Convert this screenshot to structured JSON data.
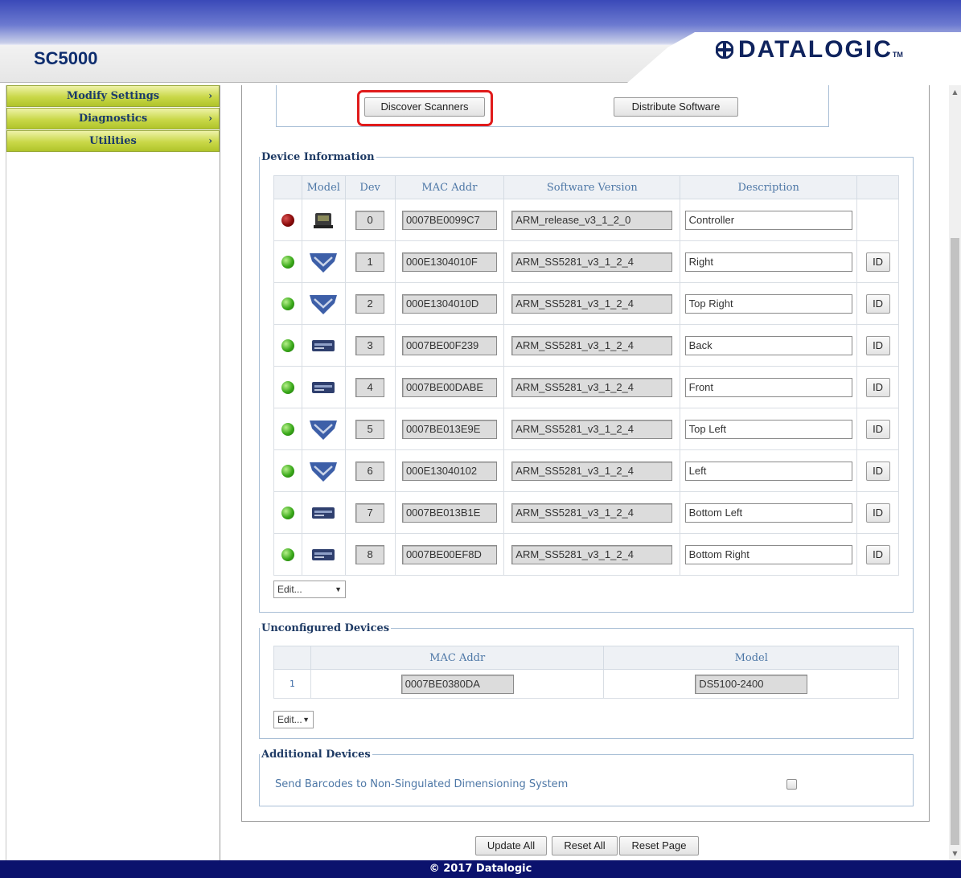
{
  "header": {
    "app_title": "SC5000",
    "brand": "DATALOGIC",
    "brand_tm": "TM"
  },
  "sidebar": {
    "items": [
      {
        "label": "Modify Settings",
        "chevron": "›"
      },
      {
        "label": "Diagnostics",
        "chevron": "›"
      },
      {
        "label": "Utilities",
        "chevron": "›"
      }
    ]
  },
  "actions": {
    "discover_label": "Discover Scanners",
    "distribute_label": "Distribute Software"
  },
  "device_info": {
    "legend": "Device Information",
    "columns": [
      "",
      "Model",
      "Dev",
      "MAC Addr",
      "Software Version",
      "Description",
      ""
    ],
    "rows": [
      {
        "status": "red",
        "model_icon": "controller-icon",
        "dev": "0",
        "mac": "0007BE0099C7",
        "software": "ARM_release_v3_1_2_0",
        "description": "Controller",
        "id_label": ""
      },
      {
        "status": "green",
        "model_icon": "v-scanner-icon",
        "dev": "1",
        "mac": "000E1304010F",
        "software": "ARM_SS5281_v3_1_2_4",
        "description": "Right",
        "id_label": "ID"
      },
      {
        "status": "green",
        "model_icon": "v-scanner-icon",
        "dev": "2",
        "mac": "000E1304010D",
        "software": "ARM_SS5281_v3_1_2_4",
        "description": "Top Right",
        "id_label": "ID"
      },
      {
        "status": "green",
        "model_icon": "box-scanner-icon",
        "dev": "3",
        "mac": "0007BE00F239",
        "software": "ARM_SS5281_v3_1_2_4",
        "description": "Back",
        "id_label": "ID"
      },
      {
        "status": "green",
        "model_icon": "box-scanner-icon",
        "dev": "4",
        "mac": "0007BE00DABE",
        "software": "ARM_SS5281_v3_1_2_4",
        "description": "Front",
        "id_label": "ID"
      },
      {
        "status": "green",
        "model_icon": "v-scanner-icon",
        "dev": "5",
        "mac": "0007BE013E9E",
        "software": "ARM_SS5281_v3_1_2_4",
        "description": "Top Left",
        "id_label": "ID"
      },
      {
        "status": "green",
        "model_icon": "v-scanner-icon",
        "dev": "6",
        "mac": "000E13040102",
        "software": "ARM_SS5281_v3_1_2_4",
        "description": "Left",
        "id_label": "ID"
      },
      {
        "status": "green",
        "model_icon": "box-scanner-icon",
        "dev": "7",
        "mac": "0007BE013B1E",
        "software": "ARM_SS5281_v3_1_2_4",
        "description": "Bottom Left",
        "id_label": "ID"
      },
      {
        "status": "green",
        "model_icon": "box-scanner-icon",
        "dev": "8",
        "mac": "0007BE00EF8D",
        "software": "ARM_SS5281_v3_1_2_4",
        "description": "Bottom Right",
        "id_label": "ID"
      }
    ],
    "edit_select": "Edit..."
  },
  "unconfigured": {
    "legend": "Unconfigured Devices",
    "columns": [
      "",
      "MAC Addr",
      "Model"
    ],
    "rows": [
      {
        "index": "1",
        "mac": "0007BE0380DA",
        "model": "DS5100-2400"
      }
    ],
    "edit_select": "Edit..."
  },
  "additional": {
    "legend": "Additional Devices",
    "send_barcodes_label": "Send Barcodes to Non-Singulated Dimensioning System",
    "send_barcodes_checked": false
  },
  "bottom_buttons": {
    "update_all": "Update All",
    "reset_all": "Reset All",
    "reset_page": "Reset Page"
  },
  "footer": {
    "copyright": "© 2017 Datalogic"
  },
  "colors": {
    "status_red": "#8b0b0b",
    "status_green": "#3aa91a",
    "highlight": "#e01b1b",
    "footer_bg": "#0b126d"
  }
}
